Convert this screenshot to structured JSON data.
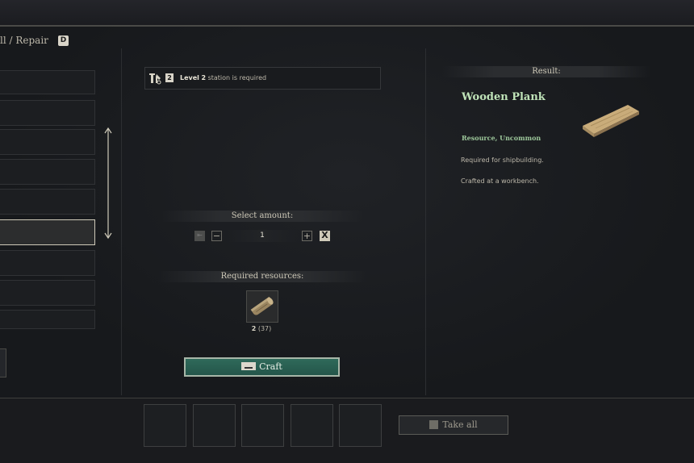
{
  "header": {
    "title": "ll / Repair",
    "hotkey": "D"
  },
  "requirement": {
    "level_word": "Level",
    "level": "2",
    "text": "station is required",
    "badge": "2"
  },
  "amount": {
    "label": "Select amount:",
    "value": "1",
    "minus": "−",
    "plus": "+",
    "cancel": "X"
  },
  "resources": {
    "label": "Required resources:",
    "needed": "2",
    "have": "(37)"
  },
  "craft_button": {
    "label": "Craft"
  },
  "result": {
    "header": "Result:",
    "name": "Wooden Plank",
    "type": "Resource, Uncommon",
    "description_1": "Required for shipbuilding.",
    "description_2": "Crafted at a workbench."
  },
  "take_all_button": {
    "label": "Take all"
  },
  "colors": {
    "craft_button": "#2f6a5a",
    "item_name": "#bfe3b8",
    "item_type": "#9cc69a"
  },
  "icons": [
    "crafting-station-icon",
    "scroll-arrow-icon",
    "wood-log-icon",
    "wooden-plank-icon",
    "keyboard-key-icon"
  ]
}
